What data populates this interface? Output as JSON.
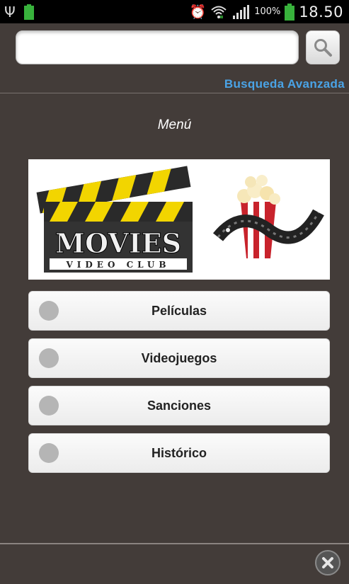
{
  "status_bar": {
    "battery_percent": "100%",
    "time": "18.50",
    "icons": [
      "usb-icon",
      "battery-icon",
      "alarm-icon",
      "wifi-icon",
      "signal-icon"
    ]
  },
  "search": {
    "value": "",
    "placeholder": "",
    "button_icon": "search-icon",
    "advanced_link": "Busqueda Avanzada"
  },
  "main": {
    "title": "Menú",
    "banner": {
      "logo_text": "MOVIES",
      "logo_subtext": "VIDEO CLUB"
    },
    "items": [
      {
        "label": "Películas"
      },
      {
        "label": "Videojuegos"
      },
      {
        "label": "Sanciones"
      },
      {
        "label": "Histórico"
      }
    ]
  },
  "footer": {
    "close_icon": "close-icon"
  },
  "colors": {
    "background": "#433c39",
    "accent_link": "#4aa3e6",
    "battery": "#38b23c"
  }
}
